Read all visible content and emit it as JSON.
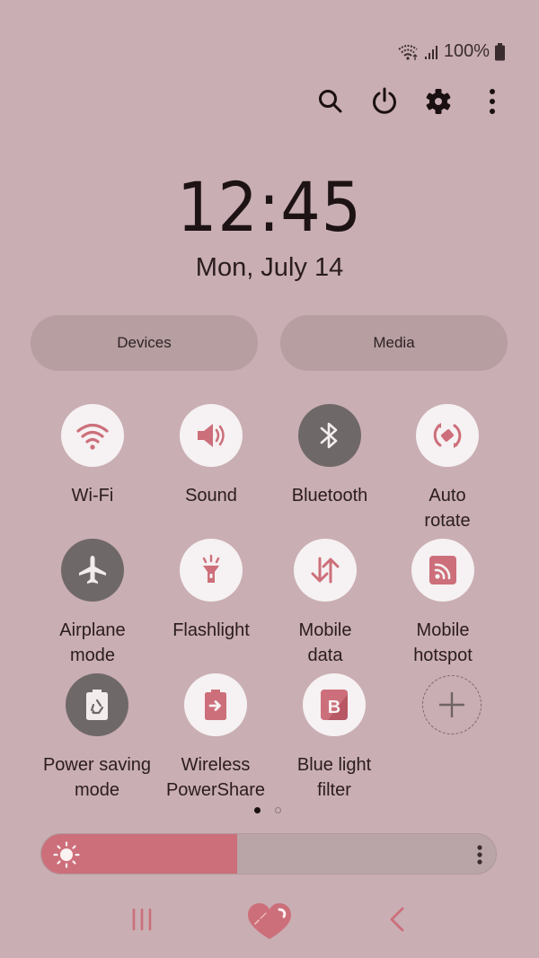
{
  "status_bar": {
    "battery_text": "100%",
    "icons": [
      "wifi-icon",
      "signal-icon",
      "battery-icon"
    ]
  },
  "top_actions": [
    {
      "name": "search",
      "icon": "search-icon"
    },
    {
      "name": "power",
      "icon": "power-icon"
    },
    {
      "name": "settings",
      "icon": "gear-icon"
    },
    {
      "name": "more",
      "icon": "more-vertical-icon"
    }
  ],
  "clock": {
    "time": "12:45",
    "date": "Mon, July 14"
  },
  "panels": {
    "devices_label": "Devices",
    "media_label": "Media"
  },
  "tiles": [
    {
      "label": "Wi-Fi",
      "icon": "wifi-icon",
      "state": "on"
    },
    {
      "label": "Sound",
      "icon": "sound-icon",
      "state": "on"
    },
    {
      "label": "Bluetooth",
      "icon": "bluetooth-icon",
      "state": "off"
    },
    {
      "label": "Auto rotate",
      "icon": "auto-rotate-icon",
      "state": "on"
    },
    {
      "label": "Airplane mode",
      "icon": "airplane-icon",
      "state": "off"
    },
    {
      "label": "Flashlight",
      "icon": "flashlight-icon",
      "state": "on"
    },
    {
      "label": "Mobile data",
      "icon": "mobile-data-icon",
      "state": "on"
    },
    {
      "label": "Mobile hotspot",
      "icon": "hotspot-icon",
      "state": "on"
    },
    {
      "label": "Power saving mode",
      "icon": "power-saving-icon",
      "state": "off"
    },
    {
      "label": "Wireless PowerShare",
      "icon": "wireless-powershare-icon",
      "state": "on"
    },
    {
      "label": "Blue light filter",
      "icon": "blue-light-filter-icon",
      "state": "on"
    },
    {
      "label": "",
      "icon": "add-icon",
      "state": "add"
    }
  ],
  "pager": {
    "current_page": 1,
    "total_pages": 2
  },
  "brightness": {
    "level_percent": 43
  },
  "colors": {
    "accent": "#cc6f7a",
    "background": "#c9aeb3",
    "tile_on": "#f6f1f2",
    "tile_off": "#6f6869"
  },
  "navbar": {
    "buttons": [
      "recents-icon",
      "home-heart-icon",
      "back-icon"
    ]
  }
}
